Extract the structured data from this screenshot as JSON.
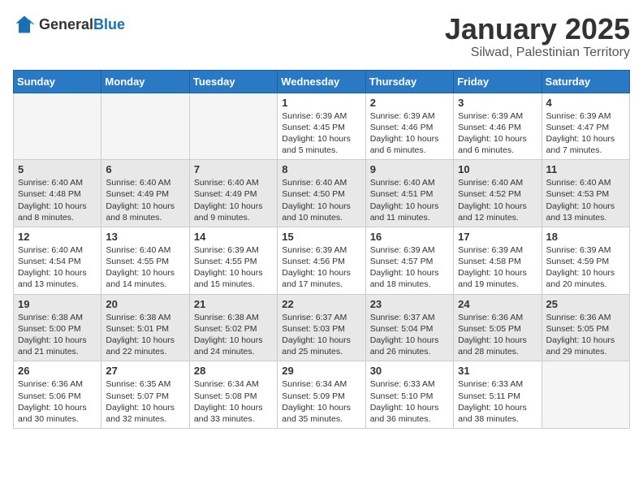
{
  "logo": {
    "general": "General",
    "blue": "Blue"
  },
  "title": "January 2025",
  "location": "Silwad, Palestinian Territory",
  "weekdays": [
    "Sunday",
    "Monday",
    "Tuesday",
    "Wednesday",
    "Thursday",
    "Friday",
    "Saturday"
  ],
  "weeks": [
    [
      {
        "day": "",
        "info": ""
      },
      {
        "day": "",
        "info": ""
      },
      {
        "day": "",
        "info": ""
      },
      {
        "day": "1",
        "info": "Sunrise: 6:39 AM\nSunset: 4:45 PM\nDaylight: 10 hours\nand 5 minutes."
      },
      {
        "day": "2",
        "info": "Sunrise: 6:39 AM\nSunset: 4:46 PM\nDaylight: 10 hours\nand 6 minutes."
      },
      {
        "day": "3",
        "info": "Sunrise: 6:39 AM\nSunset: 4:46 PM\nDaylight: 10 hours\nand 6 minutes."
      },
      {
        "day": "4",
        "info": "Sunrise: 6:39 AM\nSunset: 4:47 PM\nDaylight: 10 hours\nand 7 minutes."
      }
    ],
    [
      {
        "day": "5",
        "info": "Sunrise: 6:40 AM\nSunset: 4:48 PM\nDaylight: 10 hours\nand 8 minutes."
      },
      {
        "day": "6",
        "info": "Sunrise: 6:40 AM\nSunset: 4:49 PM\nDaylight: 10 hours\nand 8 minutes."
      },
      {
        "day": "7",
        "info": "Sunrise: 6:40 AM\nSunset: 4:49 PM\nDaylight: 10 hours\nand 9 minutes."
      },
      {
        "day": "8",
        "info": "Sunrise: 6:40 AM\nSunset: 4:50 PM\nDaylight: 10 hours\nand 10 minutes."
      },
      {
        "day": "9",
        "info": "Sunrise: 6:40 AM\nSunset: 4:51 PM\nDaylight: 10 hours\nand 11 minutes."
      },
      {
        "day": "10",
        "info": "Sunrise: 6:40 AM\nSunset: 4:52 PM\nDaylight: 10 hours\nand 12 minutes."
      },
      {
        "day": "11",
        "info": "Sunrise: 6:40 AM\nSunset: 4:53 PM\nDaylight: 10 hours\nand 13 minutes."
      }
    ],
    [
      {
        "day": "12",
        "info": "Sunrise: 6:40 AM\nSunset: 4:54 PM\nDaylight: 10 hours\nand 13 minutes."
      },
      {
        "day": "13",
        "info": "Sunrise: 6:40 AM\nSunset: 4:55 PM\nDaylight: 10 hours\nand 14 minutes."
      },
      {
        "day": "14",
        "info": "Sunrise: 6:39 AM\nSunset: 4:55 PM\nDaylight: 10 hours\nand 15 minutes."
      },
      {
        "day": "15",
        "info": "Sunrise: 6:39 AM\nSunset: 4:56 PM\nDaylight: 10 hours\nand 17 minutes."
      },
      {
        "day": "16",
        "info": "Sunrise: 6:39 AM\nSunset: 4:57 PM\nDaylight: 10 hours\nand 18 minutes."
      },
      {
        "day": "17",
        "info": "Sunrise: 6:39 AM\nSunset: 4:58 PM\nDaylight: 10 hours\nand 19 minutes."
      },
      {
        "day": "18",
        "info": "Sunrise: 6:39 AM\nSunset: 4:59 PM\nDaylight: 10 hours\nand 20 minutes."
      }
    ],
    [
      {
        "day": "19",
        "info": "Sunrise: 6:38 AM\nSunset: 5:00 PM\nDaylight: 10 hours\nand 21 minutes."
      },
      {
        "day": "20",
        "info": "Sunrise: 6:38 AM\nSunset: 5:01 PM\nDaylight: 10 hours\nand 22 minutes."
      },
      {
        "day": "21",
        "info": "Sunrise: 6:38 AM\nSunset: 5:02 PM\nDaylight: 10 hours\nand 24 minutes."
      },
      {
        "day": "22",
        "info": "Sunrise: 6:37 AM\nSunset: 5:03 PM\nDaylight: 10 hours\nand 25 minutes."
      },
      {
        "day": "23",
        "info": "Sunrise: 6:37 AM\nSunset: 5:04 PM\nDaylight: 10 hours\nand 26 minutes."
      },
      {
        "day": "24",
        "info": "Sunrise: 6:36 AM\nSunset: 5:05 PM\nDaylight: 10 hours\nand 28 minutes."
      },
      {
        "day": "25",
        "info": "Sunrise: 6:36 AM\nSunset: 5:05 PM\nDaylight: 10 hours\nand 29 minutes."
      }
    ],
    [
      {
        "day": "26",
        "info": "Sunrise: 6:36 AM\nSunset: 5:06 PM\nDaylight: 10 hours\nand 30 minutes."
      },
      {
        "day": "27",
        "info": "Sunrise: 6:35 AM\nSunset: 5:07 PM\nDaylight: 10 hours\nand 32 minutes."
      },
      {
        "day": "28",
        "info": "Sunrise: 6:34 AM\nSunset: 5:08 PM\nDaylight: 10 hours\nand 33 minutes."
      },
      {
        "day": "29",
        "info": "Sunrise: 6:34 AM\nSunset: 5:09 PM\nDaylight: 10 hours\nand 35 minutes."
      },
      {
        "day": "30",
        "info": "Sunrise: 6:33 AM\nSunset: 5:10 PM\nDaylight: 10 hours\nand 36 minutes."
      },
      {
        "day": "31",
        "info": "Sunrise: 6:33 AM\nSunset: 5:11 PM\nDaylight: 10 hours\nand 38 minutes."
      },
      {
        "day": "",
        "info": ""
      }
    ]
  ]
}
